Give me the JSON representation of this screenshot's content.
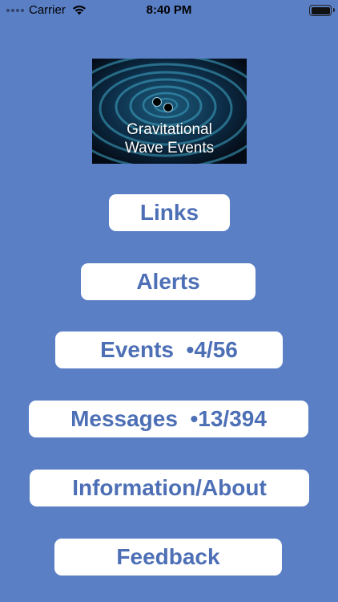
{
  "status_bar": {
    "carrier": "Carrier",
    "time": "8:40 PM",
    "wifi_icon": "wifi-icon",
    "battery_icon": "battery-icon"
  },
  "logo": {
    "line1": "Gravitational",
    "line2": "Wave Events"
  },
  "menu": {
    "links": "Links",
    "alerts": "Alerts",
    "events": "Events  •4/56",
    "messages": "Messages  •13/394",
    "information": "Information/About",
    "feedback": "Feedback"
  },
  "colors": {
    "background": "#5a7fc5",
    "button_bg": "#ffffff",
    "button_text": "#4d6fb5"
  }
}
